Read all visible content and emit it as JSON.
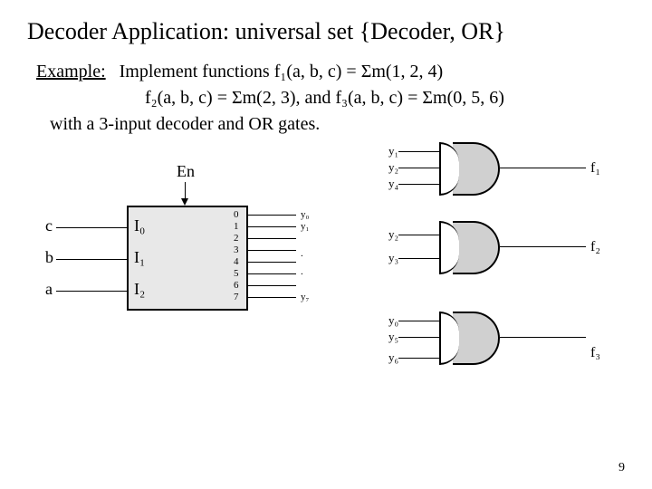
{
  "title": "Decoder Application: universal set {Decoder, OR}",
  "example_label": "Example:",
  "line1": "Implement functions f₁(a, b, c) = Σm(1, 2, 4)",
  "line2": "f₂(a, b, c) = Σm(2, 3), and  f₃(a, b, c) = Σm(0, 5, 6)",
  "line3": "with a 3-input decoder and OR gates.",
  "enable": "En",
  "inputs": {
    "c": "c",
    "b": "b",
    "a": "a"
  },
  "decoder_inputs": {
    "i0": "I₀",
    "i1": "I₁",
    "i2": "I₂"
  },
  "decoder_nums": [
    "0",
    "1",
    "2",
    "3",
    "4",
    "5",
    "6",
    "7"
  ],
  "decoder_outs": {
    "y0": "y₀",
    "y1": "y₁",
    "y7": "y₇",
    "dot": "."
  },
  "gate1": {
    "in": [
      "y₁",
      "y₂",
      "y₄"
    ],
    "out": "f₁"
  },
  "gate2": {
    "in": [
      "y₂",
      "y₃"
    ],
    "out": "f₂"
  },
  "gate3": {
    "in": [
      "y₀",
      "y₅",
      "y₆"
    ],
    "out": "f₃"
  },
  "page": "9"
}
